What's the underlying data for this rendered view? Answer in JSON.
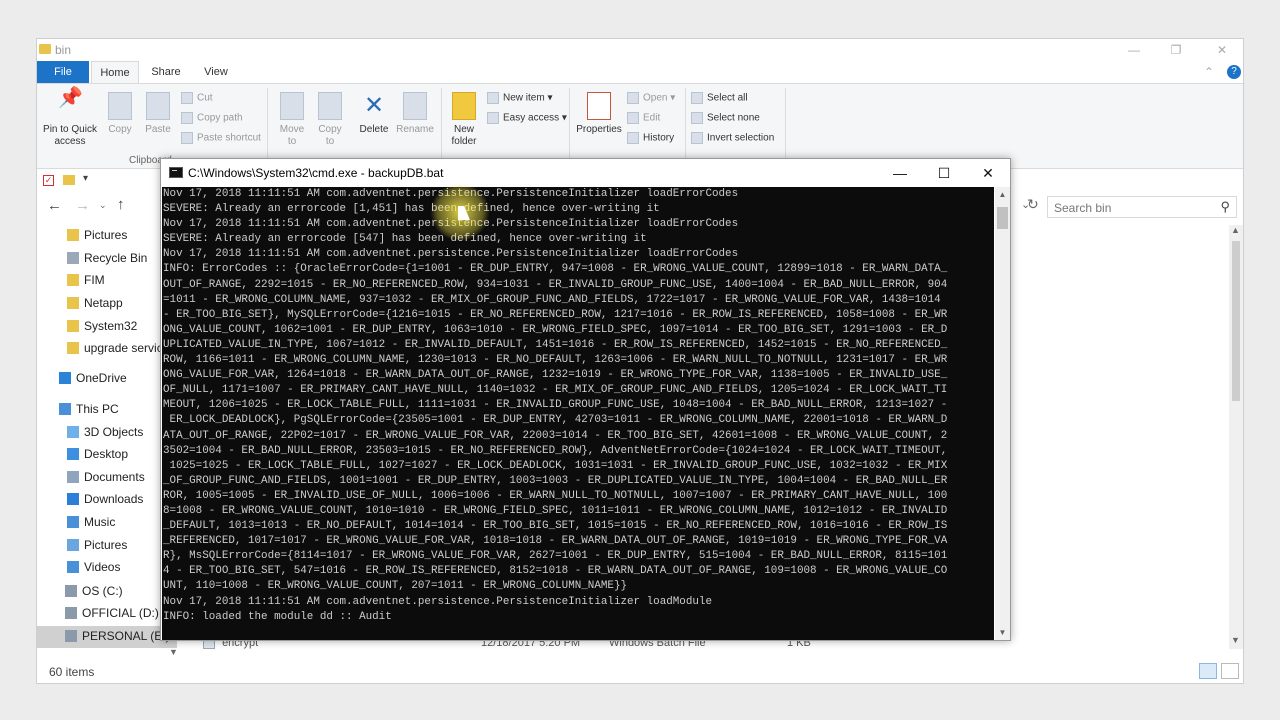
{
  "explorer": {
    "title": "bin",
    "tabs": [
      "File",
      "Home",
      "Share",
      "View"
    ],
    "ribbon": {
      "clipboard_group": "Clipboard",
      "pin_label": "Pin to Quick access",
      "copy": "Copy",
      "paste": "Paste",
      "cut": "Cut",
      "copy_path": "Copy path",
      "paste_shortcut": "Paste shortcut",
      "move_to": "Move to",
      "copy_to": "Copy to",
      "delete": "Delete",
      "rename": "Rename",
      "new_folder": "New folder",
      "new_item": "New item",
      "easy_access": "Easy access",
      "properties": "Properties",
      "open": "Open",
      "edit": "Edit",
      "history": "History",
      "select_all": "Select all",
      "select_none": "Select none",
      "invert_selection": "Invert selection"
    },
    "search_placeholder": "Search bin",
    "sidebar": [
      {
        "label": "Pictures",
        "icon": "pictures-icon",
        "color": "#e9c44a"
      },
      {
        "label": "Recycle Bin",
        "icon": "recycle-bin-icon",
        "color": "#9aa9b8"
      },
      {
        "label": "FIM",
        "icon": "folder-icon",
        "color": "#e9c44a"
      },
      {
        "label": "Netapp",
        "icon": "folder-icon",
        "color": "#e9c44a"
      },
      {
        "label": "System32",
        "icon": "folder-icon",
        "color": "#e9c44a"
      },
      {
        "label": "upgrade service",
        "icon": "folder-icon",
        "color": "#e9c44a"
      },
      {
        "label": "OneDrive",
        "icon": "onedrive-icon",
        "color": "#2a84d6"
      },
      {
        "label": "This PC",
        "icon": "computer-icon",
        "color": "#4a90d9"
      },
      {
        "label": "3D Objects",
        "icon": "3d-objects-icon",
        "color": "#6fb1e6"
      },
      {
        "label": "Desktop",
        "icon": "desktop-icon",
        "color": "#3d8fe0"
      },
      {
        "label": "Documents",
        "icon": "documents-icon",
        "color": "#8fa5bc"
      },
      {
        "label": "Downloads",
        "icon": "downloads-icon",
        "color": "#2b7fd6"
      },
      {
        "label": "Music",
        "icon": "music-icon",
        "color": "#4a90d9"
      },
      {
        "label": "Pictures",
        "icon": "pictures-icon",
        "color": "#6aa7e0"
      },
      {
        "label": "Videos",
        "icon": "videos-icon",
        "color": "#4a90d9"
      },
      {
        "label": "OS (C:)",
        "icon": "drive-icon",
        "color": "#8a9aaa"
      },
      {
        "label": "OFFICIAL (D:)",
        "icon": "drive-icon",
        "color": "#8a9aaa"
      },
      {
        "label": "PERSONAL (E:)",
        "icon": "drive-icon",
        "color": "#8a9aaa"
      }
    ],
    "file_row": {
      "name": "encrypt",
      "date": "12/18/2017 5:20 PM",
      "type": "Windows Batch File",
      "size": "1 KB"
    },
    "status": "60 items"
  },
  "cmd": {
    "title": "C:\\Windows\\System32\\cmd.exe - backupDB.bat",
    "lines": [
      "Nov 17, 2018 11:11:51 AM com.adventnet.persistence.PersistenceInitializer loadErrorCodes",
      "SEVERE: Already an errorcode [1,451] has been defined, hence over-writing it",
      "Nov 17, 2018 11:11:51 AM com.adventnet.persistence.PersistenceInitializer loadErrorCodes",
      "SEVERE: Already an errorcode [547] has been defined, hence over-writing it",
      "Nov 17, 2018 11:11:51 AM com.adventnet.persistence.PersistenceInitializer loadErrorCodes",
      "INFO: ErrorCodes :: {OracleErrorCode={1=1001 - ER_DUP_ENTRY, 947=1008 - ER_WRONG_VALUE_COUNT, 12899=1018 - ER_WARN_DATA_",
      "OUT_OF_RANGE, 2292=1015 - ER_NO_REFERENCED_ROW, 934=1031 - ER_INVALID_GROUP_FUNC_USE, 1400=1004 - ER_BAD_NULL_ERROR, 904",
      "=1011 - ER_WRONG_COLUMN_NAME, 937=1032 - ER_MIX_OF_GROUP_FUNC_AND_FIELDS, 1722=1017 - ER_WRONG_VALUE_FOR_VAR, 1438=1014",
      "- ER_TOO_BIG_SET}, MySQLErrorCode={1216=1015 - ER_NO_REFERENCED_ROW, 1217=1016 - ER_ROW_IS_REFERENCED, 1058=1008 - ER_WR",
      "ONG_VALUE_COUNT, 1062=1001 - ER_DUP_ENTRY, 1063=1010 - ER_WRONG_FIELD_SPEC, 1097=1014 - ER_TOO_BIG_SET, 1291=1003 - ER_D",
      "UPLICATED_VALUE_IN_TYPE, 1067=1012 - ER_INVALID_DEFAULT, 1451=1016 - ER_ROW_IS_REFERENCED, 1452=1015 - ER_NO_REFERENCED_",
      "ROW, 1166=1011 - ER_WRONG_COLUMN_NAME, 1230=1013 - ER_NO_DEFAULT, 1263=1006 - ER_WARN_NULL_TO_NOTNULL, 1231=1017 - ER_WR",
      "ONG_VALUE_FOR_VAR, 1264=1018 - ER_WARN_DATA_OUT_OF_RANGE, 1232=1019 - ER_WRONG_TYPE_FOR_VAR, 1138=1005 - ER_INVALID_USE_",
      "OF_NULL, 1171=1007 - ER_PRIMARY_CANT_HAVE_NULL, 1140=1032 - ER_MIX_OF_GROUP_FUNC_AND_FIELDS, 1205=1024 - ER_LOCK_WAIT_TI",
      "MEOUT, 1206=1025 - ER_LOCK_TABLE_FULL, 1111=1031 - ER_INVALID_GROUP_FUNC_USE, 1048=1004 - ER_BAD_NULL_ERROR, 1213=1027 -",
      " ER_LOCK_DEADLOCK}, PgSQLErrorCode={23505=1001 - ER_DUP_ENTRY, 42703=1011 - ER_WRONG_COLUMN_NAME, 22001=1018 - ER_WARN_D",
      "ATA_OUT_OF_RANGE, 22P02=1017 - ER_WRONG_VALUE_FOR_VAR, 22003=1014 - ER_TOO_BIG_SET, 42601=1008 - ER_WRONG_VALUE_COUNT, 2",
      "3502=1004 - ER_BAD_NULL_ERROR, 23503=1015 - ER_NO_REFERENCED_ROW}, AdventNetErrorCode={1024=1024 - ER_LOCK_WAIT_TIMEOUT,",
      " 1025=1025 - ER_LOCK_TABLE_FULL, 1027=1027 - ER_LOCK_DEADLOCK, 1031=1031 - ER_INVALID_GROUP_FUNC_USE, 1032=1032 - ER_MIX",
      "_OF_GROUP_FUNC_AND_FIELDS, 1001=1001 - ER_DUP_ENTRY, 1003=1003 - ER_DUPLICATED_VALUE_IN_TYPE, 1004=1004 - ER_BAD_NULL_ER",
      "ROR, 1005=1005 - ER_INVALID_USE_OF_NULL, 1006=1006 - ER_WARN_NULL_TO_NOTNULL, 1007=1007 - ER_PRIMARY_CANT_HAVE_NULL, 100",
      "8=1008 - ER_WRONG_VALUE_COUNT, 1010=1010 - ER_WRONG_FIELD_SPEC, 1011=1011 - ER_WRONG_COLUMN_NAME, 1012=1012 - ER_INVALID",
      "_DEFAULT, 1013=1013 - ER_NO_DEFAULT, 1014=1014 - ER_TOO_BIG_SET, 1015=1015 - ER_NO_REFERENCED_ROW, 1016=1016 - ER_ROW_IS",
      "_REFERENCED, 1017=1017 - ER_WRONG_VALUE_FOR_VAR, 1018=1018 - ER_WARN_DATA_OUT_OF_RANGE, 1019=1019 - ER_WRONG_TYPE_FOR_VA",
      "R}, MsSQLErrorCode={8114=1017 - ER_WRONG_VALUE_FOR_VAR, 2627=1001 - ER_DUP_ENTRY, 515=1004 - ER_BAD_NULL_ERROR, 8115=101",
      "4 - ER_TOO_BIG_SET, 547=1016 - ER_ROW_IS_REFERENCED, 8152=1018 - ER_WARN_DATA_OUT_OF_RANGE, 109=1008 - ER_WRONG_VALUE_CO",
      "UNT, 110=1008 - ER_WRONG_VALUE_COUNT, 207=1011 - ER_WRONG_COLUMN_NAME}}",
      "Nov 17, 2018 11:11:51 AM com.adventnet.persistence.PersistenceInitializer loadModule",
      "INFO: loaded the module dd :: Audit"
    ]
  }
}
